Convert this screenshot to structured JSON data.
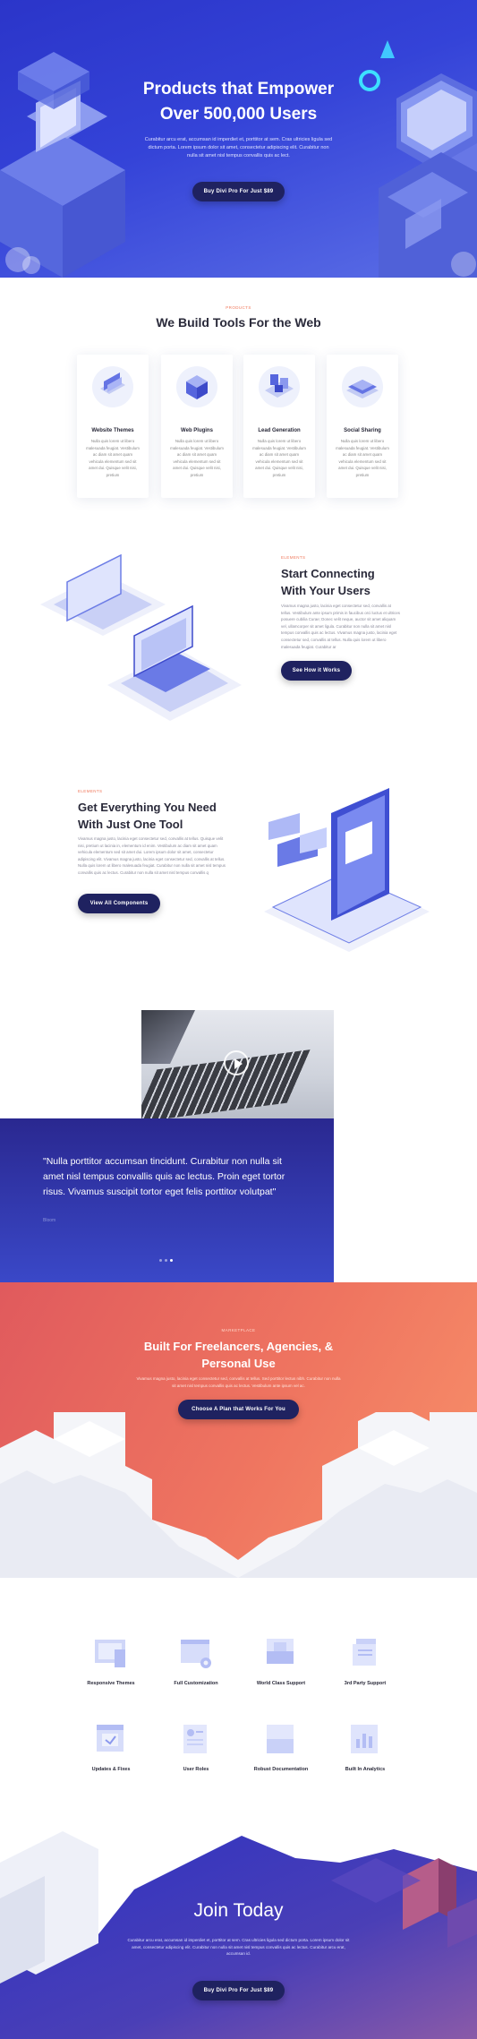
{
  "hero": {
    "title_line1": "Products that Empower",
    "title_line2": "Over 500,000 Users",
    "subtitle": "Curabitur arcu erat, accumsan id imperdiet et, porttitor at sem. Cras ultricies ligula sed dictum porta. Lorem ipsum dolor sit amet, consectetur adipiscing elit. Curabitur non nulla sit amet nisl tempus convallis quis ac lect.",
    "button": "Buy Divi Pro For Just $89"
  },
  "tools": {
    "kicker": "PRODUCTS",
    "title": "We Build Tools For the Web",
    "cards": [
      {
        "title": "Website Themes",
        "text": "Nulla quis lorem ut libero malesuada feugiat. Vestibulum ac diam sit amet quam vehicula elementum sed sit amet dui. Quisque velit nisi, pretium",
        "icon": "browser-layers-icon"
      },
      {
        "title": "Web Plugins",
        "text": "Nulla quis lorem ut libero malesuada feugiat. Vestibulum ac diam sit amet quam vehicula elementum sed sit amet dui. Quisque velit nisi, pretium",
        "icon": "cube-stack-icon"
      },
      {
        "title": "Lead Generation",
        "text": "Nulla quis lorem ut libero malesuada feugiat. Vestibulum ac diam sit amet quam vehicula elementum sed sit amet dui. Quisque velit nisi, pretium",
        "icon": "funnel-grid-icon"
      },
      {
        "title": "Social Sharing",
        "text": "Nulla quis lorem ut libero malesuada feugiat. Vestibulum ac diam sit amet quam vehicula elementum sed sit amet dui. Quisque velit nisi, pretium",
        "icon": "layered-plates-icon"
      }
    ]
  },
  "connect": {
    "kicker": "ELEMENTS",
    "title_line1": "Start Connecting",
    "title_line2": "With Your Users",
    "text": "Vivamus magna justo, lacinia eget consectetur sed, convallis at tellus. Vestibulum ante ipsum primis in faucibus orci luctus et ultrices posuere cubilia Curae; Donec velit neque, auctor sit amet aliquam vel, ullamcorper sit amet ligula. Curabitur non nulla sit amet nisl tempus convallis quis ac lectus. Vivamus magna justo, lacinia eget consectetur sed, convallis at tellus. Nulla quis lorem ut libero malesuada feugiat. Curabitur ar",
    "button": "See How it Works"
  },
  "everything": {
    "kicker": "ELEMENTS",
    "title_line1": "Get Everything You Need",
    "title_line2": "With Just One Tool",
    "text": "Vivamus magna justo, lacinia eget consectetur sed, convallis at tellus. Quisque velit nisi, pretium ut lacinia in, elementum id enim. Vestibulum ac diam sit amet quam vehicula elementum sed sit amet dui. Lorem ipsum dolor sit amet, consectetur adipiscing elit. Vivamus magna justo, lacinia eget consectetur sed, convallis at tellus. Nulla quis lorem ut libero malesuada feugiat. Curabitur non nulla sit amet nisl tempus convallis quis ac lectus. Curabitur non nulla sit amet nisl tempus convallis q",
    "button": "View All Components"
  },
  "quote": {
    "text": "\"Nulla porttitor accumsan tincidunt. Curabitur non nulla sit amet nisl tempus convallis quis ac lectus. Proin eget tortor risus. Vivamus suscipit tortor eget felis porttitor volutpat\"",
    "author": "Bloom"
  },
  "freelance": {
    "kicker": "MARKETPLACE",
    "title_line1": "Built For Freelancers, Agencies, &",
    "title_line2": "Personal Use",
    "text": "Vivamus magna justo, lacinia eget consectetur sed, convallis at tellus. Sed porttitor lectus nibh. Curabitur non nulla sit amet nisl tempus convallis quis ac lectus. Vestibulum ante ipsum vel ac.",
    "button": "Choose A Plan that Works For You"
  },
  "features": [
    {
      "label": "Responsive Themes",
      "icon": "responsive-devices-icon"
    },
    {
      "label": "Full Customization",
      "icon": "settings-panel-icon"
    },
    {
      "label": "World Class Support",
      "icon": "support-inbox-icon"
    },
    {
      "label": "3rd Party Support",
      "icon": "layered-docs-icon"
    },
    {
      "label": "Updates & Fixes",
      "icon": "update-window-icon"
    },
    {
      "label": "User Roles",
      "icon": "user-roles-icon"
    },
    {
      "label": "Robust Documentation",
      "icon": "documentation-icon"
    },
    {
      "label": "Built In Analytics",
      "icon": "analytics-chart-icon"
    }
  ],
  "join": {
    "title": "Join Today",
    "text": "Curabitur arcu erat, accumsan id imperdiet et, porttitor at sem. Cras ultricies ligula sed dictum porta. Lorem ipsum dolor sit amet, consectetur adipiscing elit. Curabitur non nulla sit amet nisl tempus convallis quis ac lectus. Curabitur arcu erat, accumsan id.",
    "button": "Buy Divi Pro For Just $89"
  },
  "colors": {
    "hero_blue": "#3443d8",
    "navy_button": "#1f2260",
    "accent_coral": "#f0785b",
    "freelance_red": "#e05a5d"
  }
}
